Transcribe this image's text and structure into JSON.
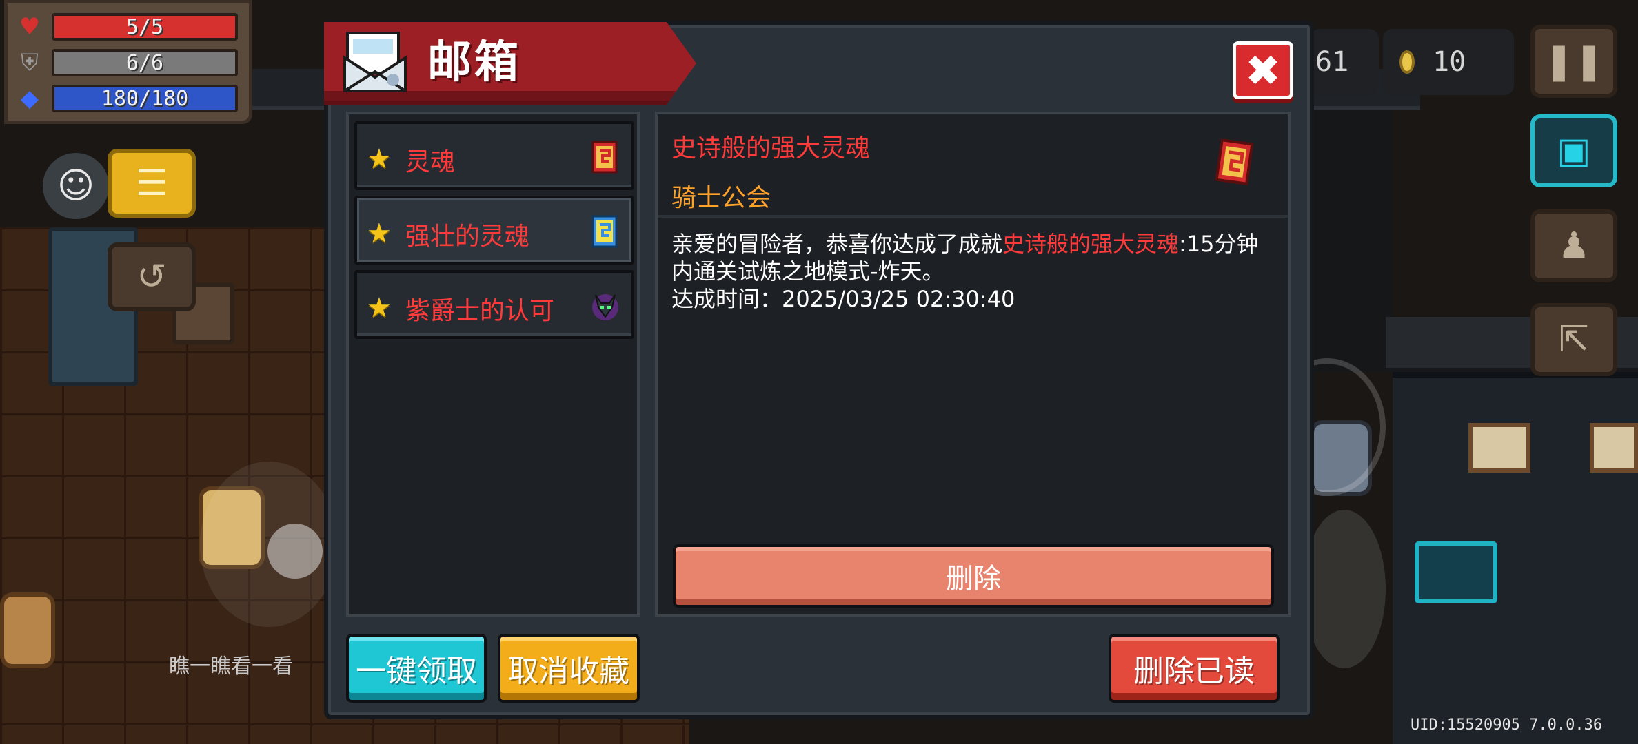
{
  "hud": {
    "hp": {
      "text": "5/5",
      "current": 5,
      "max": 5,
      "color": "#d6312f"
    },
    "armor": {
      "text": "6/6",
      "current": 6,
      "max": 6,
      "color": "#7a7a7a"
    },
    "energy": {
      "text": "180/180",
      "current": 180,
      "max": 180,
      "color": "#2f56c9"
    },
    "gem_partial": "61",
    "coins": "10",
    "uid_text": "UID:15520905 7.0.0.36",
    "hint_text": "瞧一瞧看一看"
  },
  "mail": {
    "title": "邮箱",
    "close_icon": "close-icon",
    "items": [
      {
        "label": "灵魂",
        "icon": "red-soul-card-icon"
      },
      {
        "label": "强壮的灵魂",
        "icon": "blue-soul-card-icon"
      },
      {
        "label": "紫爵士的认可",
        "icon": "purple-knight-helmet-icon"
      }
    ],
    "detail": {
      "title": "史诗般的强大灵魂",
      "sender": "骑士公会",
      "body_part1": "亲爱的冒险者，恭喜你达成了成就",
      "body_highlight": "史诗般的强大灵魂",
      "body_part2": ":15分钟内通关试炼之地模式-炸天。",
      "time_line": "达成时间：2025/03/25 02:30:40",
      "delete_label": "删除"
    },
    "buttons": {
      "claim_all": "一键领取",
      "unfavorite": "取消收藏",
      "delete_read": "删除已读"
    }
  },
  "colors": {
    "banner_red": "#9b1f24",
    "claim_cyan": "#1fc6d4",
    "unfav_orange": "#f3ac1a",
    "delete_read_red": "#e44a3c",
    "delete_salmon": "#e8836e",
    "highlight_red": "#ff3a3a",
    "sender_orange": "#ffa22a"
  }
}
